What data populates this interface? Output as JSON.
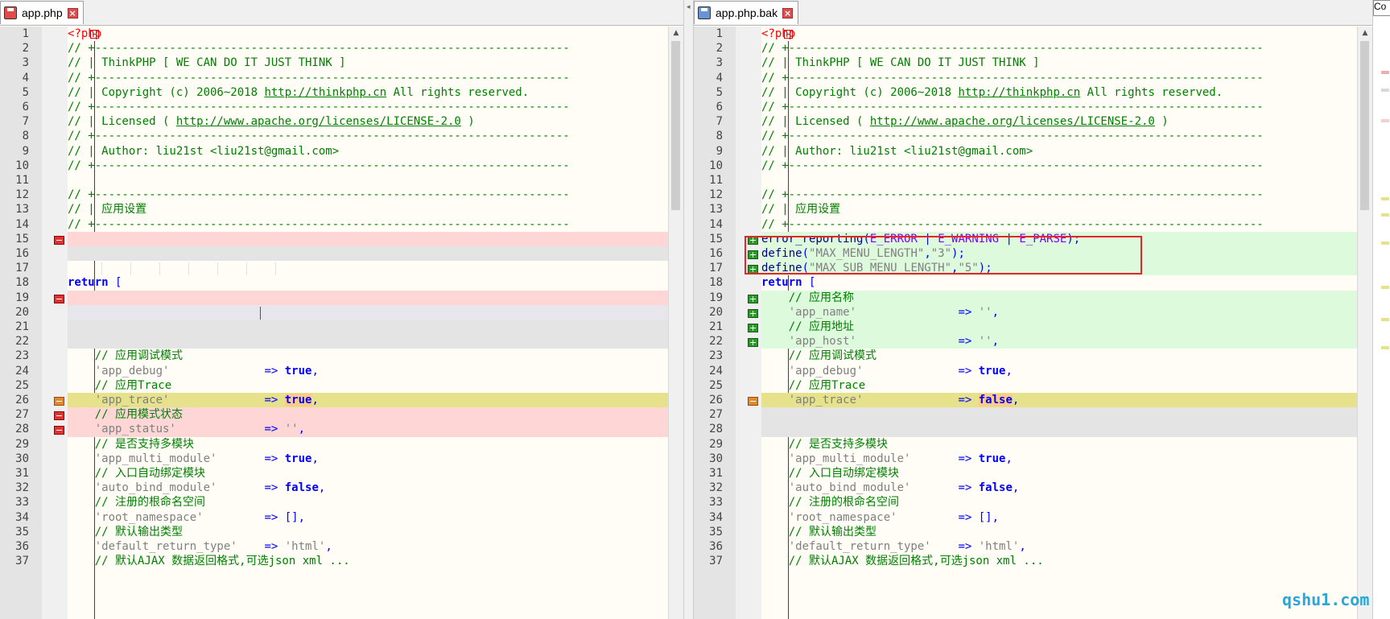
{
  "left_tab": {
    "label": "app.php"
  },
  "right_tab": {
    "label": "app.php.bak"
  },
  "right_extra": "Co",
  "watermark": "qshu1.com",
  "left_lines": [
    {
      "n": "1",
      "s": [
        [
          "php",
          "<?php"
        ]
      ]
    },
    {
      "n": "2",
      "s": [
        [
          "com",
          "// +----------------------------------------------------------------------"
        ]
      ]
    },
    {
      "n": "3",
      "s": [
        [
          "com",
          "// | ThinkPHP [ WE CAN DO IT JUST THINK ]"
        ]
      ]
    },
    {
      "n": "4",
      "s": [
        [
          "com",
          "// +----------------------------------------------------------------------"
        ]
      ]
    },
    {
      "n": "5",
      "s": [
        [
          "com",
          "// | Copyright (c) 2006~2018 "
        ],
        [
          "comurl",
          "http://thinkphp.cn"
        ],
        [
          "com",
          " All rights reserved."
        ]
      ]
    },
    {
      "n": "6",
      "s": [
        [
          "com",
          "// +----------------------------------------------------------------------"
        ]
      ]
    },
    {
      "n": "7",
      "s": [
        [
          "com",
          "// | Licensed ( "
        ],
        [
          "comurl",
          "http://www.apache.org/licenses/LICENSE-2.0"
        ],
        [
          "com",
          " )"
        ]
      ]
    },
    {
      "n": "8",
      "s": [
        [
          "com",
          "// +----------------------------------------------------------------------"
        ]
      ]
    },
    {
      "n": "9",
      "s": [
        [
          "com",
          "// | Author: liu21st <liu21st@gmail.com>"
        ]
      ]
    },
    {
      "n": "10",
      "s": [
        [
          "com",
          "// +----------------------------------------------------------------------"
        ]
      ]
    },
    {
      "n": "11",
      "s": []
    },
    {
      "n": "12",
      "s": [
        [
          "com",
          "// +----------------------------------------------------------------------"
        ]
      ]
    },
    {
      "n": "13",
      "s": [
        [
          "com",
          "// | 应用设置"
        ]
      ]
    },
    {
      "n": "14",
      "s": [
        [
          "com",
          "// +----------------------------------------------------------------------"
        ]
      ]
    },
    {
      "n": "15",
      "s": [],
      "bg": "del",
      "mk": "del"
    },
    {
      "n": "16",
      "s": [],
      "bg": "gray"
    },
    {
      "n": "17",
      "s": []
    },
    {
      "n": "18",
      "s": [
        [
          "kw",
          "return"
        ],
        [
          "op",
          " ["
        ]
      ]
    },
    {
      "n": "19",
      "s": [],
      "bg": "del",
      "mk": "del"
    },
    {
      "n": "20",
      "s": [],
      "bg": "lav"
    },
    {
      "n": "21",
      "s": [],
      "bg": "gray"
    },
    {
      "n": "22",
      "s": [],
      "bg": "gray"
    },
    {
      "n": "23",
      "s": [
        [
          "com",
          "    // 应用调试模式"
        ]
      ]
    },
    {
      "n": "24",
      "s": [
        [
          "str",
          "    'app_debug'"
        ],
        [
          "plain",
          "              "
        ],
        [
          "op",
          "=>"
        ],
        [
          "kw",
          " true"
        ],
        [
          "op",
          ","
        ]
      ]
    },
    {
      "n": "25",
      "s": [
        [
          "com",
          "    // 应用Trace"
        ]
      ]
    },
    {
      "n": "26",
      "s": [
        [
          "str",
          "    'app_trace'"
        ],
        [
          "plain",
          "              "
        ],
        [
          "op",
          "=>"
        ],
        [
          "plain",
          " "
        ],
        [
          "kwhl",
          "true"
        ],
        [
          "op",
          ","
        ]
      ],
      "bg": "chg",
      "mk": "chg"
    },
    {
      "n": "27",
      "s": [
        [
          "com",
          "    // 应用模式状态"
        ]
      ],
      "bg": "del",
      "mk": "del"
    },
    {
      "n": "28",
      "s": [
        [
          "str",
          "    'app_status'"
        ],
        [
          "plain",
          "             "
        ],
        [
          "op",
          "=>"
        ],
        [
          "str",
          " ''"
        ],
        [
          "op",
          ","
        ]
      ],
      "bg": "del",
      "mk": "del"
    },
    {
      "n": "29",
      "s": [
        [
          "com",
          "    // 是否支持多模块"
        ]
      ]
    },
    {
      "n": "30",
      "s": [
        [
          "str",
          "    'app_multi_module'"
        ],
        [
          "plain",
          "       "
        ],
        [
          "op",
          "=>"
        ],
        [
          "kw",
          " true"
        ],
        [
          "op",
          ","
        ]
      ]
    },
    {
      "n": "31",
      "s": [
        [
          "com",
          "    // 入口自动绑定模块"
        ]
      ]
    },
    {
      "n": "32",
      "s": [
        [
          "str",
          "    'auto_bind_module'"
        ],
        [
          "plain",
          "       "
        ],
        [
          "op",
          "=>"
        ],
        [
          "kw",
          " false"
        ],
        [
          "op",
          ","
        ]
      ]
    },
    {
      "n": "33",
      "s": [
        [
          "com",
          "    // 注册的根命名空间"
        ]
      ]
    },
    {
      "n": "34",
      "s": [
        [
          "str",
          "    'root_namespace'"
        ],
        [
          "plain",
          "         "
        ],
        [
          "op",
          "=>"
        ],
        [
          "op",
          " [],"
        ]
      ]
    },
    {
      "n": "35",
      "s": [
        [
          "com",
          "    // 默认输出类型"
        ]
      ]
    },
    {
      "n": "36",
      "s": [
        [
          "str",
          "    'default_return_type'"
        ],
        [
          "plain",
          "    "
        ],
        [
          "op",
          "=>"
        ],
        [
          "str",
          " 'html'"
        ],
        [
          "op",
          ","
        ]
      ]
    },
    {
      "n": "37",
      "s": [
        [
          "com",
          "    // 默认AJAX 数据返回格式,可选json xml ..."
        ]
      ]
    }
  ],
  "right_lines": [
    {
      "n": "1",
      "s": [
        [
          "php",
          "<?php"
        ]
      ]
    },
    {
      "n": "2",
      "s": [
        [
          "com",
          "// +----------------------------------------------------------------------"
        ]
      ]
    },
    {
      "n": "3",
      "s": [
        [
          "com",
          "// | ThinkPHP [ WE CAN DO IT JUST THINK ]"
        ]
      ]
    },
    {
      "n": "4",
      "s": [
        [
          "com",
          "// +----------------------------------------------------------------------"
        ]
      ]
    },
    {
      "n": "5",
      "s": [
        [
          "com",
          "// | Copyright (c) 2006~2018 "
        ],
        [
          "comurl",
          "http://thinkphp.cn"
        ],
        [
          "com",
          " All rights reserved."
        ]
      ]
    },
    {
      "n": "6",
      "s": [
        [
          "com",
          "// +----------------------------------------------------------------------"
        ]
      ]
    },
    {
      "n": "7",
      "s": [
        [
          "com",
          "// | Licensed ( "
        ],
        [
          "comurl",
          "http://www.apache.org/licenses/LICENSE-2.0"
        ],
        [
          "com",
          " )"
        ]
      ]
    },
    {
      "n": "8",
      "s": [
        [
          "com",
          "// +----------------------------------------------------------------------"
        ]
      ]
    },
    {
      "n": "9",
      "s": [
        [
          "com",
          "// | Author: liu21st <liu21st@gmail.com>"
        ]
      ]
    },
    {
      "n": "10",
      "s": [
        [
          "com",
          "// +----------------------------------------------------------------------"
        ]
      ]
    },
    {
      "n": "11",
      "s": []
    },
    {
      "n": "12",
      "s": [
        [
          "com",
          "// +----------------------------------------------------------------------"
        ]
      ]
    },
    {
      "n": "13",
      "s": [
        [
          "com",
          "// | 应用设置"
        ]
      ]
    },
    {
      "n": "14",
      "s": [
        [
          "com",
          "// +----------------------------------------------------------------------"
        ]
      ]
    },
    {
      "n": "15",
      "s": [
        [
          "fn",
          "error_reporting"
        ],
        [
          "op",
          "("
        ],
        [
          "const",
          "E_ERROR"
        ],
        [
          "op",
          " | "
        ],
        [
          "const",
          "E_WARNING"
        ],
        [
          "op",
          " | "
        ],
        [
          "const",
          "E_PARSE"
        ],
        [
          "op",
          ");"
        ]
      ],
      "bg": "add",
      "mk": "add"
    },
    {
      "n": "16",
      "s": [
        [
          "fn",
          "define"
        ],
        [
          "op",
          "("
        ],
        [
          "str",
          "\"MAX_MENU_LENGTH\""
        ],
        [
          "op",
          ","
        ],
        [
          "str",
          "\"3\""
        ],
        [
          "op",
          ");"
        ]
      ],
      "bg": "add",
      "mk": "add"
    },
    {
      "n": "17",
      "s": [
        [
          "fn",
          "define"
        ],
        [
          "op",
          "("
        ],
        [
          "str",
          "\"MAX_SUB_MENU_LENGTH\""
        ],
        [
          "op",
          ","
        ],
        [
          "str",
          "\"5\""
        ],
        [
          "op",
          ");"
        ]
      ],
      "bg": "add",
      "mk": "add"
    },
    {
      "n": "18",
      "s": [
        [
          "kw",
          "return"
        ],
        [
          "op",
          " ["
        ]
      ]
    },
    {
      "n": "19",
      "s": [
        [
          "com",
          "    // 应用名称"
        ]
      ],
      "bg": "add",
      "mk": "add"
    },
    {
      "n": "20",
      "s": [
        [
          "str",
          "    'app_name'"
        ],
        [
          "plain",
          "               "
        ],
        [
          "op",
          "=>"
        ],
        [
          "str",
          " ''"
        ],
        [
          "op",
          ","
        ]
      ],
      "bg": "add",
      "mk": "add"
    },
    {
      "n": "21",
      "s": [
        [
          "com",
          "    // 应用地址"
        ]
      ],
      "bg": "add",
      "mk": "add"
    },
    {
      "n": "22",
      "s": [
        [
          "str",
          "    'app_host'"
        ],
        [
          "plain",
          "               "
        ],
        [
          "op",
          "=>"
        ],
        [
          "str",
          " ''"
        ],
        [
          "op",
          ","
        ]
      ],
      "bg": "add",
      "mk": "add"
    },
    {
      "n": "23",
      "s": [
        [
          "com",
          "    // 应用调试模式"
        ]
      ]
    },
    {
      "n": "24",
      "s": [
        [
          "str",
          "    'app_debug'"
        ],
        [
          "plain",
          "              "
        ],
        [
          "op",
          "=>"
        ],
        [
          "kw",
          " true"
        ],
        [
          "op",
          ","
        ]
      ]
    },
    {
      "n": "25",
      "s": [
        [
          "com",
          "    // 应用Trace"
        ]
      ]
    },
    {
      "n": "26",
      "s": [
        [
          "str",
          "    'app_trace'"
        ],
        [
          "plain",
          "              "
        ],
        [
          "op",
          "=>"
        ],
        [
          "plain",
          " "
        ],
        [
          "kwhl",
          "false"
        ],
        [
          "op",
          ","
        ]
      ],
      "bg": "chg",
      "mk": "chg"
    },
    {
      "n": "27",
      "s": [],
      "bg": "gray"
    },
    {
      "n": "28",
      "s": [],
      "bg": "gray"
    },
    {
      "n": "29",
      "s": [
        [
          "com",
          "    // 是否支持多模块"
        ]
      ]
    },
    {
      "n": "30",
      "s": [
        [
          "str",
          "    'app_multi_module'"
        ],
        [
          "plain",
          "       "
        ],
        [
          "op",
          "=>"
        ],
        [
          "kw",
          " true"
        ],
        [
          "op",
          ","
        ]
      ]
    },
    {
      "n": "31",
      "s": [
        [
          "com",
          "    // 入口自动绑定模块"
        ]
      ]
    },
    {
      "n": "32",
      "s": [
        [
          "str",
          "    'auto_bind_module'"
        ],
        [
          "plain",
          "       "
        ],
        [
          "op",
          "=>"
        ],
        [
          "kw",
          " false"
        ],
        [
          "op",
          ","
        ]
      ]
    },
    {
      "n": "33",
      "s": [
        [
          "com",
          "    // 注册的根命名空间"
        ]
      ]
    },
    {
      "n": "34",
      "s": [
        [
          "str",
          "    'root_namespace'"
        ],
        [
          "plain",
          "         "
        ],
        [
          "op",
          "=>"
        ],
        [
          "op",
          " [],"
        ]
      ]
    },
    {
      "n": "35",
      "s": [
        [
          "com",
          "    // 默认输出类型"
        ]
      ]
    },
    {
      "n": "36",
      "s": [
        [
          "str",
          "    'default_return_type'"
        ],
        [
          "plain",
          "    "
        ],
        [
          "op",
          "=>"
        ],
        [
          "str",
          " 'html'"
        ],
        [
          "op",
          ","
        ]
      ]
    },
    {
      "n": "37",
      "s": [
        [
          "com",
          "    // 默认AJAX 数据返回格式,可选json xml ..."
        ]
      ]
    }
  ]
}
